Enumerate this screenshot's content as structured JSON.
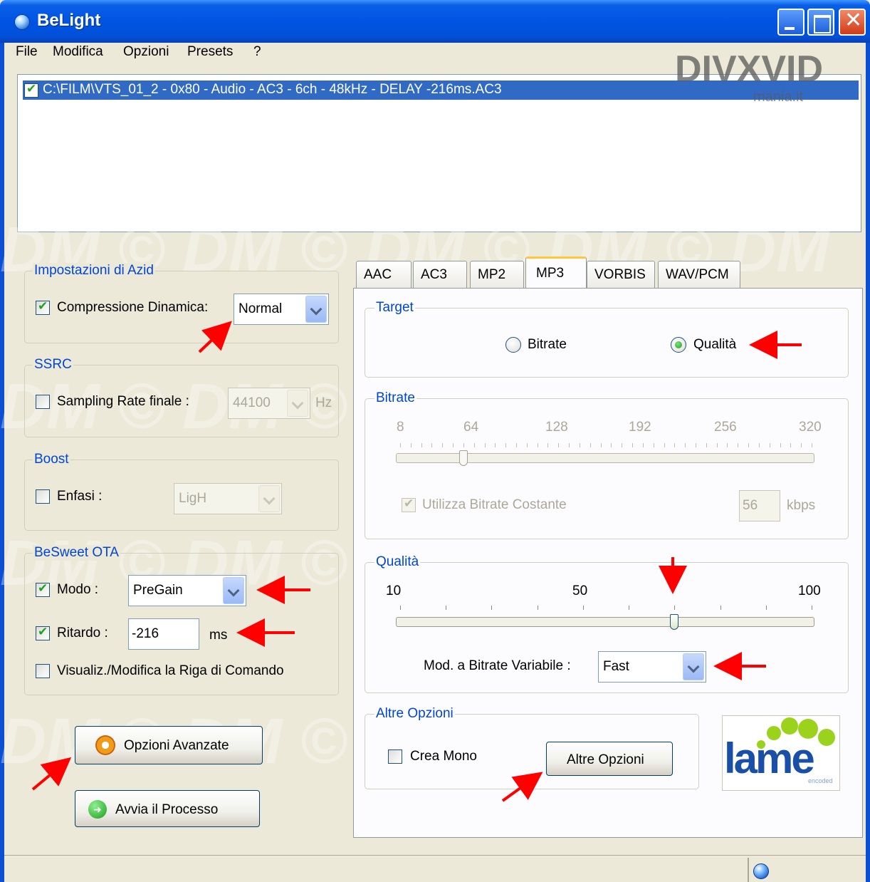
{
  "window": {
    "title": "BeLight"
  },
  "menu": [
    "File",
    "Modifica",
    "Opzioni",
    "Presets",
    "?"
  ],
  "watermark": {
    "logo_text": "DIVXVID",
    "logo_sub": "mania.it",
    "overlay_text": "DM © DM © DM © DM © DM"
  },
  "file_list": {
    "items": [
      {
        "checked": true,
        "path": "C:\\FILM\\VTS_01_2 - 0x80 - Audio - AC3 - 6ch - 48kHz - DELAY -216ms.AC3"
      }
    ]
  },
  "azid": {
    "legend": "Impostazioni di Azid",
    "dynamic_compression": {
      "label": "Compressione Dinamica:",
      "checked": true,
      "value": "Normal"
    }
  },
  "ssrc": {
    "legend": "SSRC",
    "sampling_rate": {
      "label": "Sampling Rate finale :",
      "checked": false,
      "value": "44100",
      "unit": "Hz"
    }
  },
  "boost": {
    "legend": "Boost",
    "emphasis": {
      "label": "Enfasi :",
      "checked": false,
      "value": "LigH"
    }
  },
  "besweet": {
    "legend": "BeSweet OTA",
    "mode": {
      "label": "Modo :",
      "checked": true,
      "value": "PreGain"
    },
    "delay": {
      "label": "Ritardo :",
      "checked": true,
      "value": "-216",
      "unit": "ms"
    },
    "command_line": {
      "label": "Visualiz./Modifica la Riga di Comando",
      "checked": false
    }
  },
  "buttons": {
    "advanced": "Opzioni Avanzate",
    "start": "Avvia il Processo"
  },
  "tabs": [
    "AAC",
    "AC3",
    "MP2",
    "MP3",
    "VORBIS",
    "WAV/PCM"
  ],
  "active_tab": "MP3",
  "target": {
    "legend": "Target",
    "options": [
      "Bitrate",
      "Qualità"
    ],
    "selected": "Qualità"
  },
  "bitrate": {
    "legend": "Bitrate",
    "scale_labels": [
      "8",
      "64",
      "128",
      "192",
      "256",
      "320"
    ],
    "slider_value": 56,
    "cbr": {
      "label": "Utilizza Bitrate Costante",
      "checked": true
    },
    "value": "56",
    "unit": "kbps"
  },
  "quality": {
    "legend": "Qualità",
    "scale_labels": [
      "10",
      "50",
      "100"
    ],
    "slider_value": 70,
    "vbr_mode": {
      "label": "Mod. a Bitrate Variabile :",
      "value": "Fast"
    }
  },
  "other_options": {
    "legend": "Altre Opzioni",
    "mono": {
      "label": "Crea Mono",
      "checked": false
    },
    "button": "Altre Opzioni"
  },
  "lame_logo": {
    "text": "lame",
    "sub": "encoded"
  },
  "colors": {
    "accent": "#0046d5",
    "selection": "#316ac5",
    "arrows": "#ff0000"
  }
}
